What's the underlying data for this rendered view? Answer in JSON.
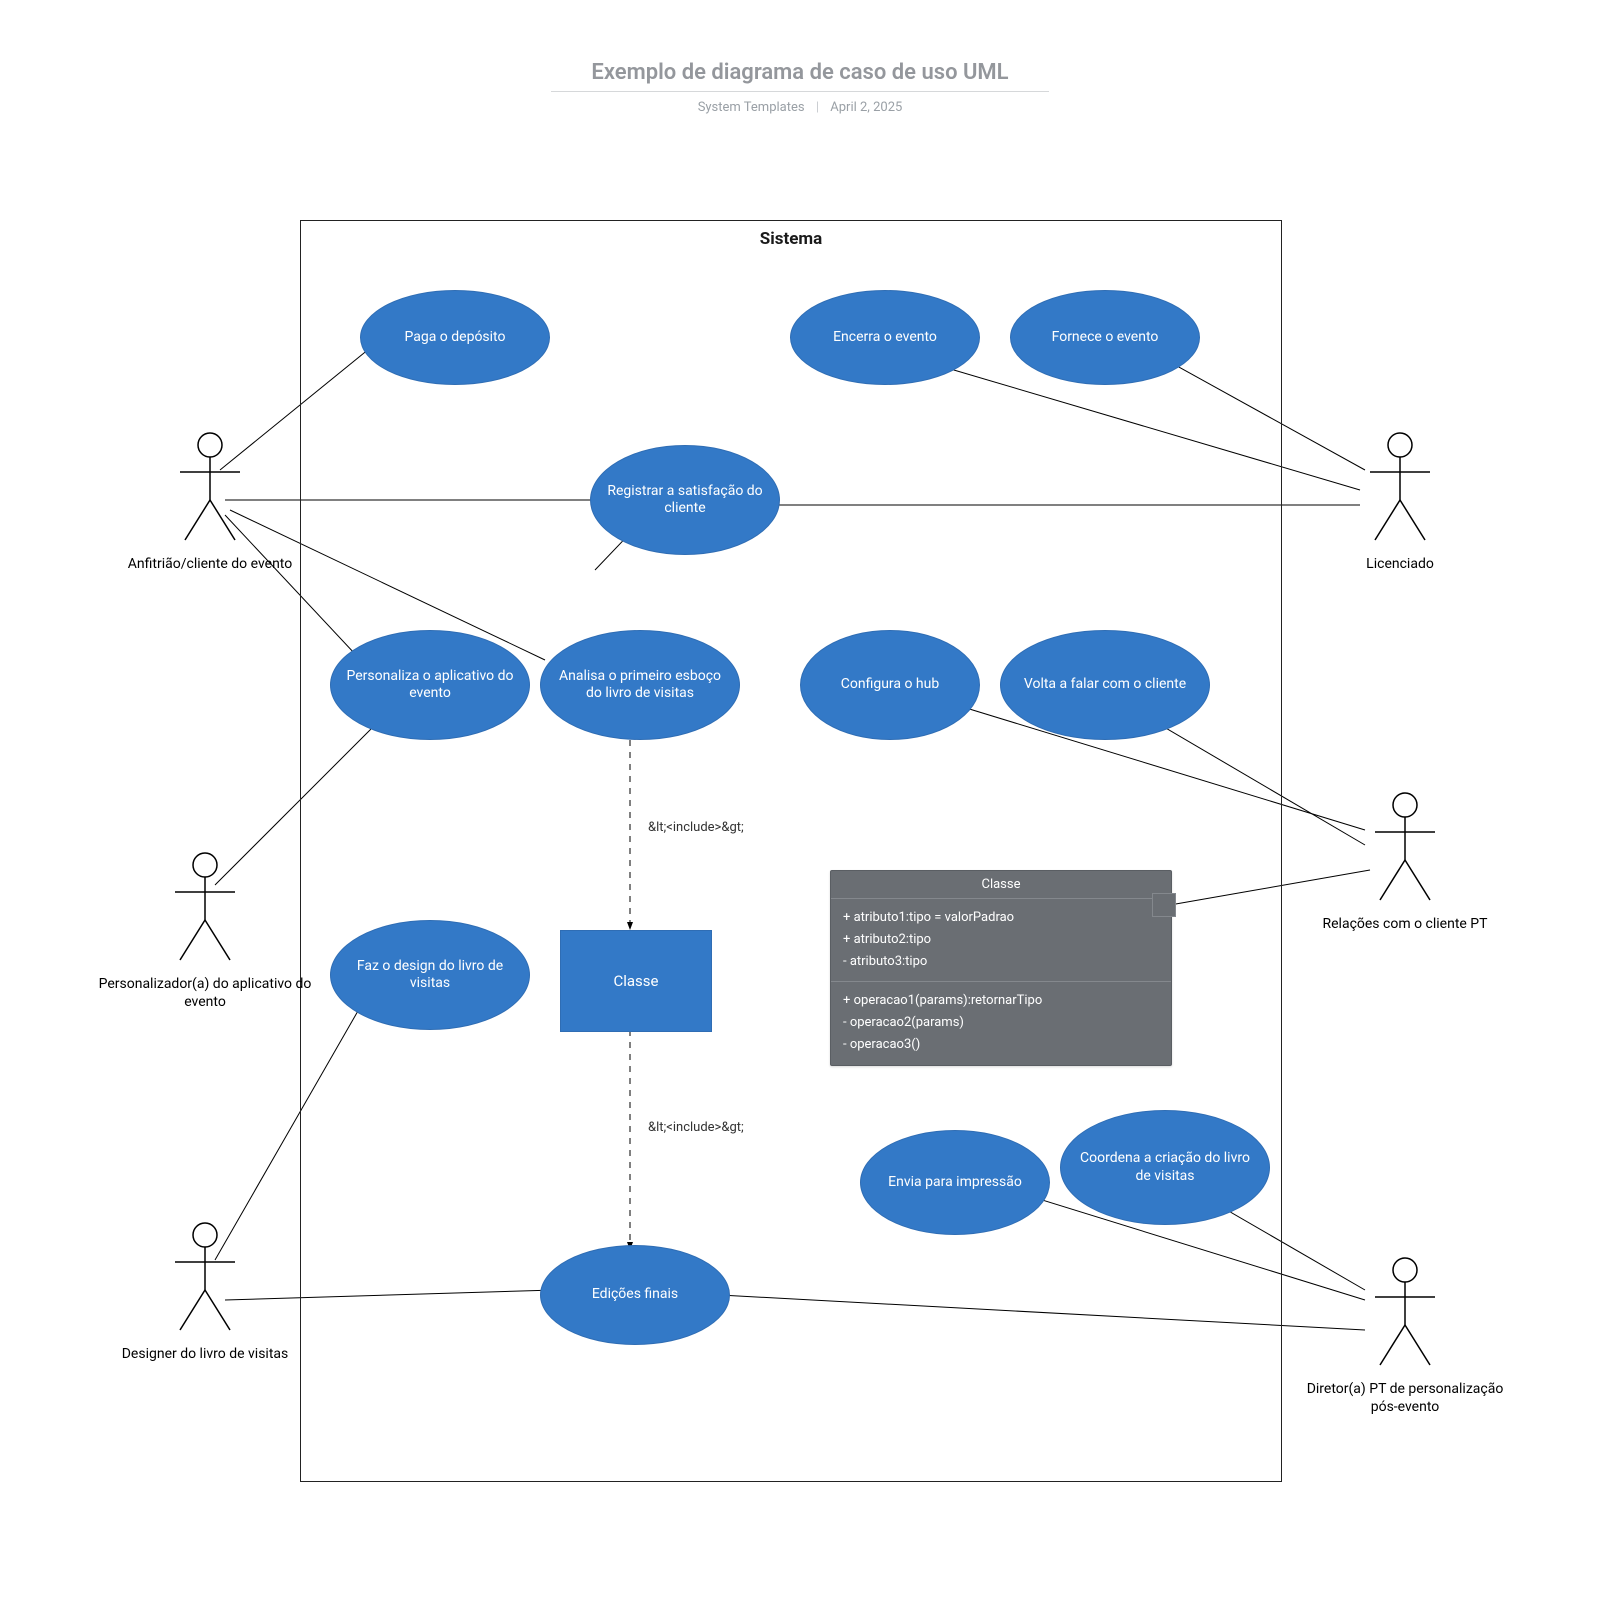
{
  "header": {
    "title": "Exemplo de diagrama de caso de uso UML",
    "author": "System Templates",
    "date": "April 2, 2025"
  },
  "system": {
    "label": "Sistema"
  },
  "actors": {
    "host": {
      "label": "Anfitrião/cliente do evento"
    },
    "customizer": {
      "label": "Personalizador(a) do aplicativo do evento"
    },
    "designer": {
      "label": "Designer do livro de visitas"
    },
    "licensee": {
      "label": "Licenciado"
    },
    "crpt": {
      "label": "Relações com o cliente PT"
    },
    "director": {
      "label": "Diretor(a) PT de personalização pós-evento"
    }
  },
  "usecases": {
    "deposit": {
      "label": "Paga o depósito"
    },
    "closes": {
      "label": "Encerra o evento"
    },
    "provides": {
      "label": "Fornece o evento"
    },
    "register": {
      "label": "Registrar a satisfação do cliente"
    },
    "personalize": {
      "label": "Personaliza o aplicativo do evento"
    },
    "analyze": {
      "label": "Analisa o primeiro esboço do livro de visitas"
    },
    "confighub": {
      "label": "Configura o hub"
    },
    "followup": {
      "label": "Volta a falar com o cliente"
    },
    "design": {
      "label": "Faz o design do livro de visitas"
    },
    "sendprint": {
      "label": "Envia para impressão"
    },
    "coord": {
      "label": "Coordena a criação do livro de visitas"
    },
    "final": {
      "label": "Edições finais"
    }
  },
  "classBox": {
    "label": "Classe"
  },
  "classCard": {
    "title": "Classe",
    "attrs": [
      "+ atributo1:tipo = valorPadrao",
      "+ atributo2:tipo",
      "- atributo3:tipo"
    ],
    "ops": [
      "+ operacao1(params):retornarTipo",
      "- operacao2(params)",
      "- operacao3()"
    ]
  },
  "includeLabels": {
    "include1": "&lt;<include>&gt;",
    "include2": "&lt;<include>&gt;"
  },
  "colors": {
    "blue": "#3379c7",
    "gray": "#6a6e73"
  },
  "associations": [
    {
      "from": "host",
      "to": [
        "deposit",
        "register",
        "personalize",
        "analyze"
      ]
    },
    {
      "from": "customizer",
      "to": [
        "personalize"
      ]
    },
    {
      "from": "designer",
      "to": [
        "design",
        "final"
      ]
    },
    {
      "from": "licensee",
      "to": [
        "closes",
        "provides",
        "register"
      ]
    },
    {
      "from": "crpt",
      "to": [
        "confighub",
        "followup",
        "classCard"
      ]
    },
    {
      "from": "director",
      "to": [
        "sendprint",
        "coord",
        "final"
      ]
    }
  ],
  "includeEdges": [
    {
      "from": "analyze",
      "to": "classBox",
      "label": "include1"
    },
    {
      "from": "classBox",
      "to": "final",
      "label": "include2"
    }
  ]
}
